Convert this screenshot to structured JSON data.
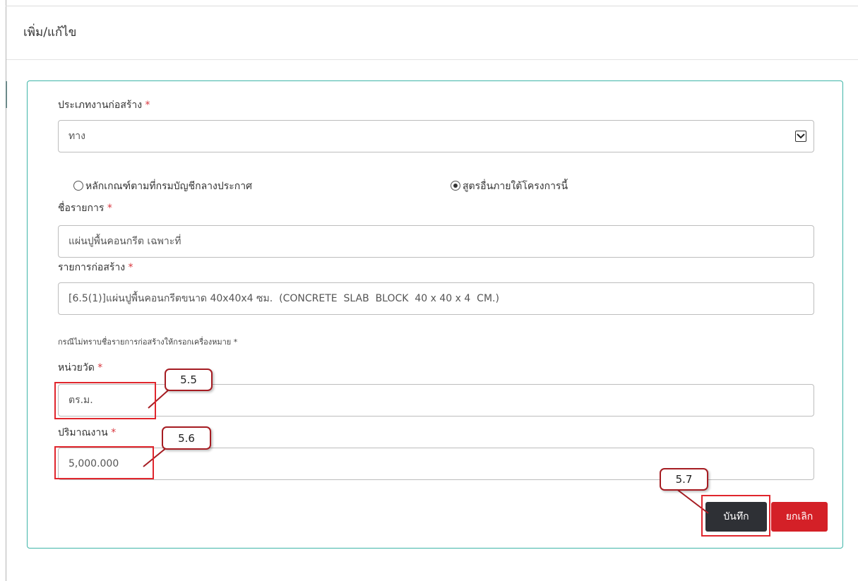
{
  "header": {
    "title": "เพิ่ม/แก้ไข"
  },
  "form": {
    "construction_type": {
      "label": "ประเภทงานก่อสร้าง",
      "required_mark": "*",
      "value": "ทาง"
    },
    "radio_options": [
      {
        "label": "หลักเกณฑ์ตามที่กรมบัญชีกลางประกาศ",
        "checked": false
      },
      {
        "label": "สูตรอื่นภายใต้โครงการนี้",
        "checked": true
      }
    ],
    "item_name": {
      "label": "ชื่อรายการ",
      "required_mark": "*",
      "value": "แผ่นปูพื้นคอนกรีต เฉพาะที่"
    },
    "construction_item": {
      "label": "รายการก่อสร้าง",
      "required_mark": "*",
      "value": "[6.5(1)]แผ่นปูพื้นคอนกรีตขนาด 40x40x4 ซม.  (CONCRETE  SLAB  BLOCK  40 x 40 x 4  CM.)"
    },
    "hint": "กรณีไม่ทราบชื่อรายการก่อสร้างให้กรอกเครื่องหมาย *",
    "unit": {
      "label": "หน่วยวัด",
      "required_mark": "*",
      "value": "ตร.ม."
    },
    "quantity": {
      "label": "ปริมาณงาน",
      "required_mark": "*",
      "value": "5,000.000"
    }
  },
  "buttons": {
    "save": "บันทึก",
    "cancel": "ยกเลิก"
  },
  "annotations": {
    "unit_callout": "5.5",
    "quantity_callout": "5.6",
    "save_callout": "5.7"
  },
  "colors": {
    "panel_border": "#3fb5a8",
    "save_button": "#2e3035",
    "cancel_button": "#d42027",
    "callout_red": "#e0262d",
    "required_star": "#d9363e"
  },
  "icons": {
    "select_arrow": "chevron-down-icon"
  }
}
